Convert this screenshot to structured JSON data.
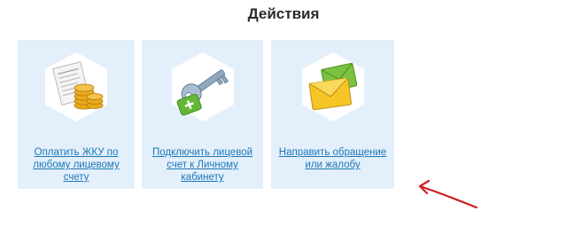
{
  "section": {
    "title": "Действия"
  },
  "cards": [
    {
      "line1": "Оплатить ЖКУ по",
      "line2": "любому лицевому счету",
      "icon": "invoice-coins-icon"
    },
    {
      "line1": "Подключить лицевой",
      "line2": "счет к Личному кабинету",
      "icon": "key-plus-icon"
    },
    {
      "line1": "Направить обращение",
      "line2": "или жалобу",
      "icon": "envelopes-icon"
    }
  ],
  "colors": {
    "card_bg": "#e3effb",
    "link": "#1d78b8",
    "annotation_arrow": "#cc1f1f"
  }
}
